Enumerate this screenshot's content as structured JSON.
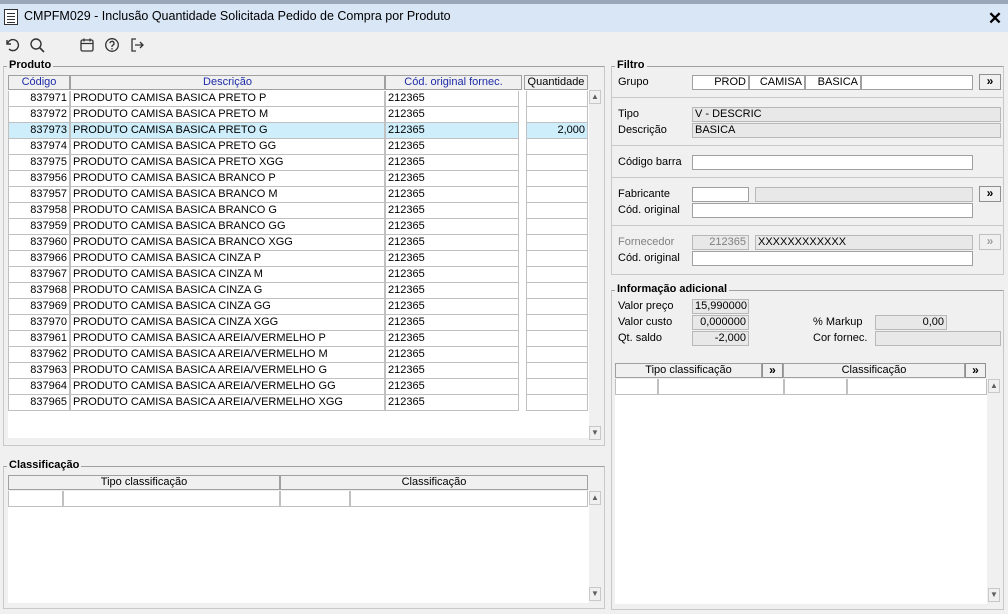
{
  "window": {
    "title": "CMPFM029 - Inclusão Quantidade Solicitada  Pedido de Compra por Produto",
    "close_label": "✕"
  },
  "toolbar": {
    "icons": [
      "undo-icon",
      "search-icon",
      "calendar-icon",
      "help-icon",
      "exit-icon"
    ]
  },
  "produto": {
    "title": "Produto",
    "columns": {
      "codigo": "Código",
      "descricao": "Descrição",
      "cod_original": "Cód. original fornec.",
      "quantidade": "Quantidade"
    },
    "rows": [
      {
        "codigo": "837971",
        "descricao": "PRODUTO CAMISA BASICA PRETO P",
        "cod_original": "212365",
        "quantidade": ""
      },
      {
        "codigo": "837972",
        "descricao": "PRODUTO CAMISA BASICA PRETO M",
        "cod_original": "212365",
        "quantidade": ""
      },
      {
        "codigo": "837973",
        "descricao": "PRODUTO CAMISA BASICA PRETO G",
        "cod_original": "212365",
        "quantidade": "2,000"
      },
      {
        "codigo": "837974",
        "descricao": "PRODUTO CAMISA BASICA PRETO GG",
        "cod_original": "212365",
        "quantidade": ""
      },
      {
        "codigo": "837975",
        "descricao": "PRODUTO CAMISA BASICA PRETO XGG",
        "cod_original": "212365",
        "quantidade": ""
      },
      {
        "codigo": "837956",
        "descricao": "PRODUTO CAMISA BASICA BRANCO P",
        "cod_original": "212365",
        "quantidade": ""
      },
      {
        "codigo": "837957",
        "descricao": "PRODUTO CAMISA BASICA BRANCO M",
        "cod_original": "212365",
        "quantidade": ""
      },
      {
        "codigo": "837958",
        "descricao": "PRODUTO CAMISA BASICA BRANCO G",
        "cod_original": "212365",
        "quantidade": ""
      },
      {
        "codigo": "837959",
        "descricao": "PRODUTO CAMISA BASICA BRANCO GG",
        "cod_original": "212365",
        "quantidade": ""
      },
      {
        "codigo": "837960",
        "descricao": "PRODUTO CAMISA BASICA BRANCO XGG",
        "cod_original": "212365",
        "quantidade": ""
      },
      {
        "codigo": "837966",
        "descricao": "PRODUTO CAMISA BASICA CINZA P",
        "cod_original": "212365",
        "quantidade": ""
      },
      {
        "codigo": "837967",
        "descricao": "PRODUTO CAMISA BASICA CINZA M",
        "cod_original": "212365",
        "quantidade": ""
      },
      {
        "codigo": "837968",
        "descricao": "PRODUTO CAMISA BASICA CINZA G",
        "cod_original": "212365",
        "quantidade": ""
      },
      {
        "codigo": "837969",
        "descricao": "PRODUTO CAMISA BASICA CINZA GG",
        "cod_original": "212365",
        "quantidade": ""
      },
      {
        "codigo": "837970",
        "descricao": "PRODUTO CAMISA BASICA CINZA XGG",
        "cod_original": "212365",
        "quantidade": ""
      },
      {
        "codigo": "837961",
        "descricao": "PRODUTO CAMISA BASICA AREIA/VERMELHO P",
        "cod_original": "212365",
        "quantidade": ""
      },
      {
        "codigo": "837962",
        "descricao": "PRODUTO CAMISA BASICA AREIA/VERMELHO M",
        "cod_original": "212365",
        "quantidade": ""
      },
      {
        "codigo": "837963",
        "descricao": "PRODUTO CAMISA BASICA AREIA/VERMELHO G",
        "cod_original": "212365",
        "quantidade": ""
      },
      {
        "codigo": "837964",
        "descricao": "PRODUTO CAMISA BASICA AREIA/VERMELHO GG",
        "cod_original": "212365",
        "quantidade": ""
      },
      {
        "codigo": "837965",
        "descricao": "PRODUTO CAMISA BASICA AREIA/VERMELHO XGG",
        "cod_original": "212365",
        "quantidade": ""
      }
    ],
    "selected_index": 2
  },
  "classificacao": {
    "title": "Classificação",
    "col_tipo": "Tipo classificação",
    "col_class": "Classificação"
  },
  "filtro": {
    "title": "Filtro",
    "grupo_label": "Grupo",
    "grupo_values": [
      "PROD",
      "CAMISA",
      "BASICA"
    ],
    "tipo_label": "Tipo",
    "tipo_value": "V - DESCRIC",
    "descricao_label": "Descrição",
    "descricao_value": "BASICA",
    "codigo_barra_label": "Código barra",
    "codigo_barra_value": "",
    "fabricante_label": "Fabricante",
    "fabricante_code": "",
    "fabricante_name": "",
    "fab_cod_original_label": "Cód. original",
    "fab_cod_original_value": "",
    "fornecedor_label": "Fornecedor",
    "fornecedor_code": "212365",
    "fornecedor_name": "XXXXXXXXXXXX",
    "forn_cod_original_label": "Cód. original",
    "forn_cod_original_value": "",
    "more_label": "»"
  },
  "info": {
    "title": "Informação adicional",
    "valor_preco_label": "Valor preço",
    "valor_preco": "15,990000",
    "valor_custo_label": "Valor custo",
    "valor_custo": "0,000000",
    "qt_saldo_label": "Qt. saldo",
    "qt_saldo": "-2,000",
    "markup_label": "% Markup",
    "markup": "0,00",
    "cor_fornec_label": "Cor fornec.",
    "cor_fornec": "",
    "col_tipo": "Tipo classificação",
    "col_class": "Classificação",
    "more_label": "»"
  },
  "colors": {
    "selected_row": "#cdeefa",
    "header_blue": "#1e2ba8",
    "titlebar": "#d9e6f6"
  }
}
